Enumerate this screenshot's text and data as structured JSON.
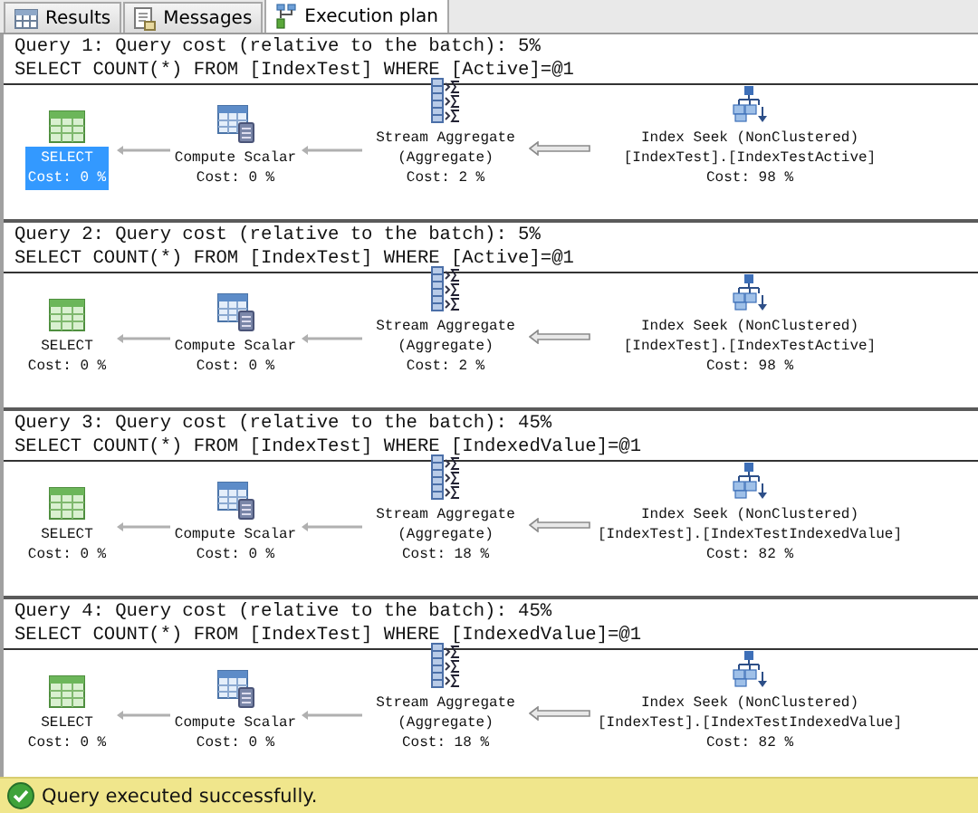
{
  "tabs": [
    {
      "label": "Results",
      "kind": "grid",
      "selected": false
    },
    {
      "label": "Messages",
      "kind": "messages",
      "selected": false
    },
    {
      "label": "Execution plan",
      "kind": "plan",
      "selected": true
    }
  ],
  "queries": [
    {
      "header": "Query 1: Query cost (relative to the batch): 5%",
      "statement": "SELECT COUNT(*) FROM [IndexTest] WHERE [Active]=@1",
      "nodes": [
        {
          "kind": "select",
          "lines": [
            "SELECT",
            "Cost: 0 %"
          ],
          "selected": true
        },
        {
          "kind": "compute",
          "lines": [
            "Compute Scalar",
            "Cost: 0 %"
          ],
          "selected": false
        },
        {
          "kind": "aggregate",
          "lines": [
            "Stream Aggregate",
            "(Aggregate)",
            "Cost: 2 %"
          ],
          "selected": false
        },
        {
          "kind": "seek",
          "lines": [
            "Index Seek (NonClustered)",
            "[IndexTest].[IndexTestActive]",
            "Cost: 98 %"
          ],
          "selected": false
        }
      ],
      "arrows": [
        {
          "thick": false
        },
        {
          "thick": false
        },
        {
          "thick": true
        }
      ]
    },
    {
      "header": "Query 2: Query cost (relative to the batch): 5%",
      "statement": "SELECT COUNT(*) FROM [IndexTest] WHERE [Active]=@1",
      "nodes": [
        {
          "kind": "select",
          "lines": [
            "SELECT",
            "Cost: 0 %"
          ],
          "selected": false
        },
        {
          "kind": "compute",
          "lines": [
            "Compute Scalar",
            "Cost: 0 %"
          ],
          "selected": false
        },
        {
          "kind": "aggregate",
          "lines": [
            "Stream Aggregate",
            "(Aggregate)",
            "Cost: 2 %"
          ],
          "selected": false
        },
        {
          "kind": "seek",
          "lines": [
            "Index Seek (NonClustered)",
            "[IndexTest].[IndexTestActive]",
            "Cost: 98 %"
          ],
          "selected": false
        }
      ],
      "arrows": [
        {
          "thick": false
        },
        {
          "thick": false
        },
        {
          "thick": true
        }
      ]
    },
    {
      "header": "Query 3: Query cost (relative to the batch): 45%",
      "statement": "SELECT COUNT(*) FROM [IndexTest] WHERE [IndexedValue]=@1",
      "nodes": [
        {
          "kind": "select",
          "lines": [
            "SELECT",
            "Cost: 0 %"
          ],
          "selected": false
        },
        {
          "kind": "compute",
          "lines": [
            "Compute Scalar",
            "Cost: 0 %"
          ],
          "selected": false
        },
        {
          "kind": "aggregate",
          "lines": [
            "Stream Aggregate",
            "(Aggregate)",
            "Cost: 18 %"
          ],
          "selected": false
        },
        {
          "kind": "seek",
          "lines": [
            "Index Seek (NonClustered)",
            "[IndexTest].[IndexTestIndexedValue]",
            "Cost: 82 %"
          ],
          "selected": false
        }
      ],
      "arrows": [
        {
          "thick": false
        },
        {
          "thick": false
        },
        {
          "thick": true
        }
      ]
    },
    {
      "header": "Query 4: Query cost (relative to the batch): 45%",
      "statement": "SELECT COUNT(*) FROM [IndexTest] WHERE [IndexedValue]=@1",
      "nodes": [
        {
          "kind": "select",
          "lines": [
            "SELECT",
            "Cost: 0 %"
          ],
          "selected": false
        },
        {
          "kind": "compute",
          "lines": [
            "Compute Scalar",
            "Cost: 0 %"
          ],
          "selected": false
        },
        {
          "kind": "aggregate",
          "lines": [
            "Stream Aggregate",
            "(Aggregate)",
            "Cost: 18 %"
          ],
          "selected": false
        },
        {
          "kind": "seek",
          "lines": [
            "Index Seek (NonClustered)",
            "[IndexTest].[IndexTestIndexedValue]",
            "Cost: 82 %"
          ],
          "selected": false
        }
      ],
      "arrows": [
        {
          "thick": false
        },
        {
          "thick": false
        },
        {
          "thick": true
        }
      ]
    }
  ],
  "status_bar": {
    "text": "Query executed successfully."
  }
}
